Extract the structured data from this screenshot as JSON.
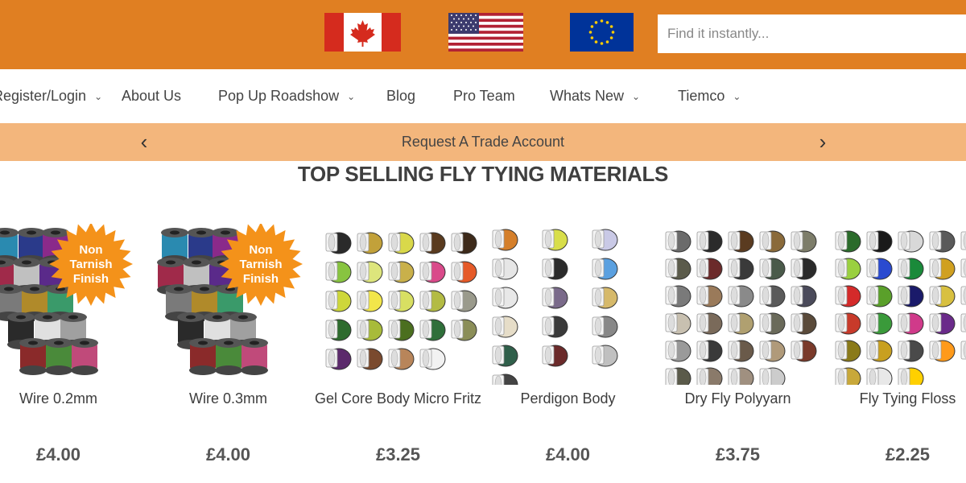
{
  "header": {
    "flags": [
      {
        "name": "Canada",
        "icon": "canada-flag-icon"
      },
      {
        "name": "United States",
        "icon": "usa-flag-icon"
      },
      {
        "name": "European Union",
        "icon": "eu-flag-icon"
      }
    ],
    "search": {
      "placeholder": "Find it instantly..."
    },
    "colors": {
      "accent": "#e07f22",
      "promo": "#f3b67c"
    }
  },
  "nav": {
    "items": [
      {
        "label": "Register/Login",
        "has_dropdown": true
      },
      {
        "label": "About Us",
        "has_dropdown": false
      },
      {
        "label": "Pop Up Roadshow",
        "has_dropdown": true
      },
      {
        "label": "Blog",
        "has_dropdown": false
      },
      {
        "label": "Pro Team",
        "has_dropdown": false
      },
      {
        "label": "Whats New",
        "has_dropdown": true
      },
      {
        "label": "Tiemco",
        "has_dropdown": true
      }
    ],
    "chevron": "⌄"
  },
  "promo": {
    "text": "Request A Trade Account",
    "prev": "‹",
    "next": "›"
  },
  "section": {
    "title": "TOP SELLING FLY TYING MATERIALS"
  },
  "products": [
    {
      "name": "Wire 0.2mm",
      "price": "£4.00",
      "badge": "Non Tarnish Finish",
      "image": "wire-spools"
    },
    {
      "name": "Wire 0.3mm",
      "price": "£4.00",
      "badge": "Non Tarnish Finish",
      "image": "wire-spools"
    },
    {
      "name": "Gel Core Body Micro Fritz",
      "price": "£3.25",
      "badge": "",
      "image": "spool-grid"
    },
    {
      "name": "Perdigon Body",
      "price": "£4.00",
      "badge": "",
      "image": "spool-grid"
    },
    {
      "name": "Dry Fly Polyyarn",
      "price": "£3.75",
      "badge": "",
      "image": "spool-grid"
    },
    {
      "name": "Fly Tying Floss",
      "price": "£2.25",
      "badge": "",
      "image": "spool-grid"
    }
  ],
  "badge_lines": [
    "Non",
    "Tarnish",
    "Finish"
  ]
}
